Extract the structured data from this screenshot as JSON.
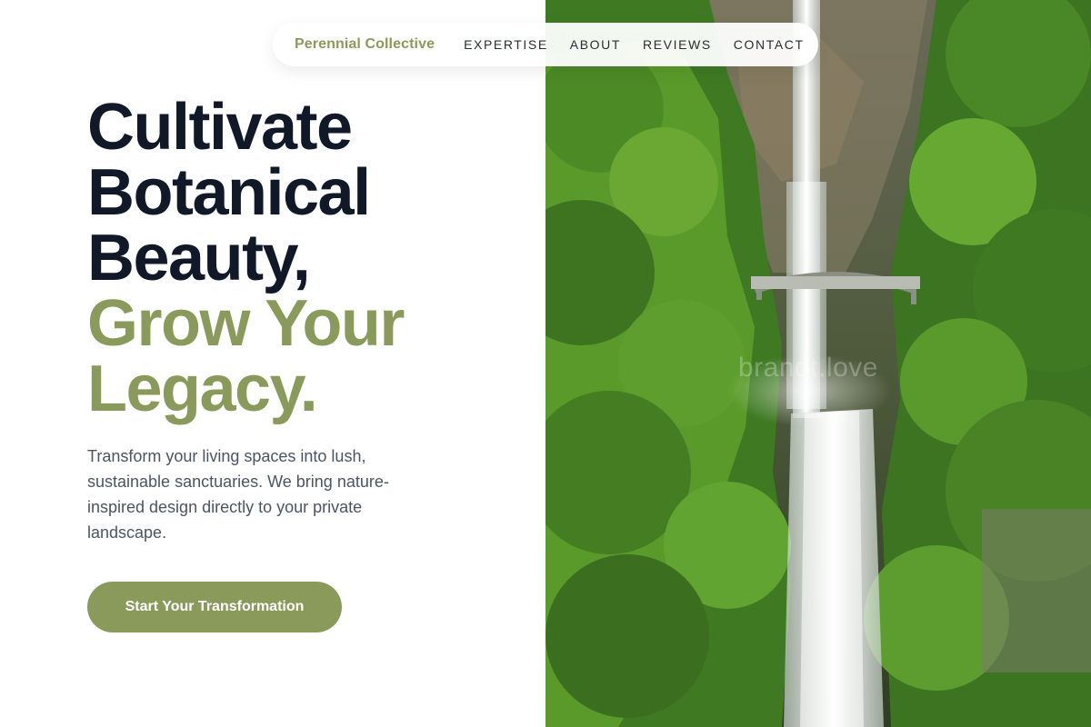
{
  "theme": {
    "accent": "#8a9a5b",
    "ink": "#111827"
  },
  "nav": {
    "brand": "Perennial Collective",
    "links": [
      "EXPERTISE",
      "ABOUT",
      "REVIEWS",
      "CONTACT"
    ]
  },
  "hero": {
    "headline_lines": [
      "Cultivate",
      "Botanical",
      "Beauty,"
    ],
    "accent_lines": [
      "Grow Your",
      "Legacy."
    ],
    "description": "Transform your living spaces into lush, sustainable sanctuaries. We bring nature-inspired design directly to your private landscape.",
    "cta_label": "Start Your Transformation",
    "image_watermark": "brandt.love"
  },
  "icons": {
    "hero_image": "waterfall-photo"
  }
}
